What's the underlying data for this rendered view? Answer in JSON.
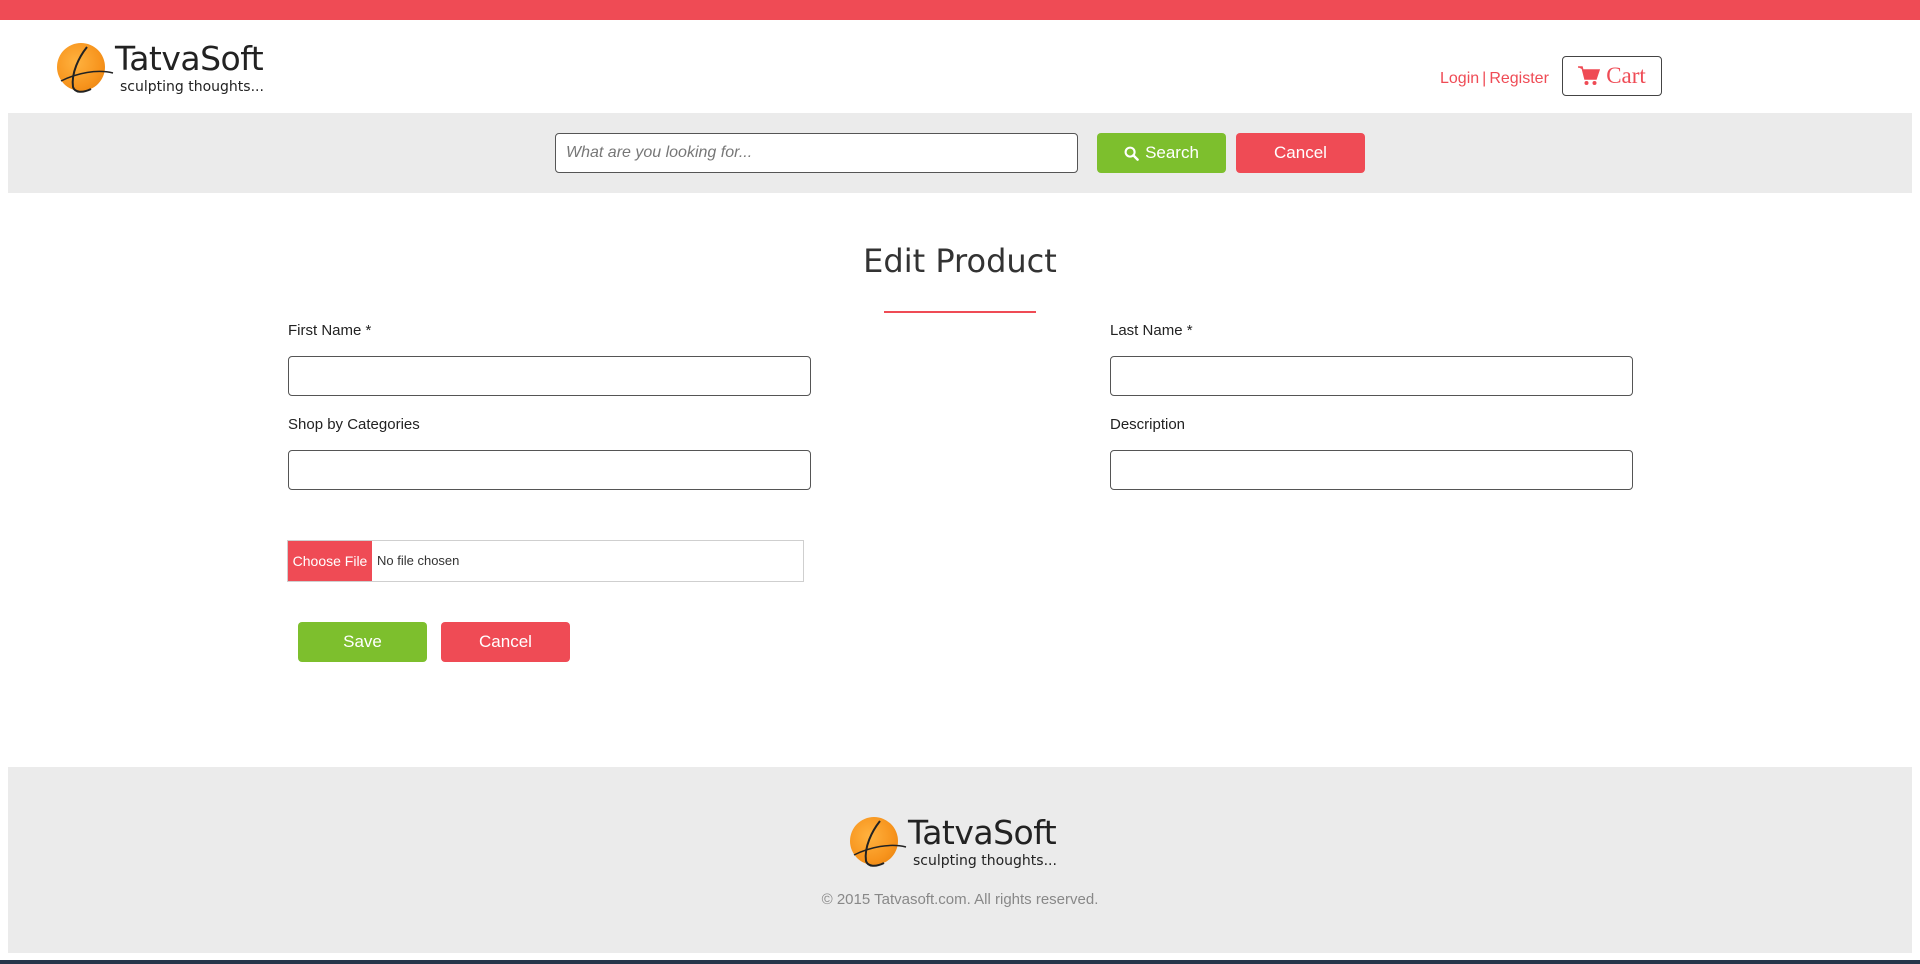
{
  "colors": {
    "accent_red": "#ef4b55",
    "accent_green": "#7dbf2d",
    "band_gray": "#ebebeb"
  },
  "brand": {
    "name": "TatvaSoft",
    "tagline": "sculpting thoughts..."
  },
  "header": {
    "login": "Login",
    "separator": "|",
    "register": "Register",
    "cart_label": "Cart",
    "cart_icon": "shopping-cart-icon"
  },
  "search": {
    "placeholder": "What are you looking for...",
    "value": "",
    "search_label": "Search",
    "search_icon": "search-icon",
    "cancel_label": "Cancel"
  },
  "form": {
    "title": "Edit Product",
    "fields": {
      "first_name": {
        "label": "First Name *",
        "value": ""
      },
      "last_name": {
        "label": "Last Name *",
        "value": ""
      },
      "categories": {
        "label": "Shop by Categories",
        "value": ""
      },
      "description": {
        "label": "Description",
        "value": ""
      }
    },
    "file": {
      "button": "Choose File",
      "status": "No file chosen"
    },
    "save_label": "Save",
    "cancel_label": "Cancel"
  },
  "footer": {
    "copyright": "© 2015 Tatvasoft.com. All rights reserved."
  }
}
